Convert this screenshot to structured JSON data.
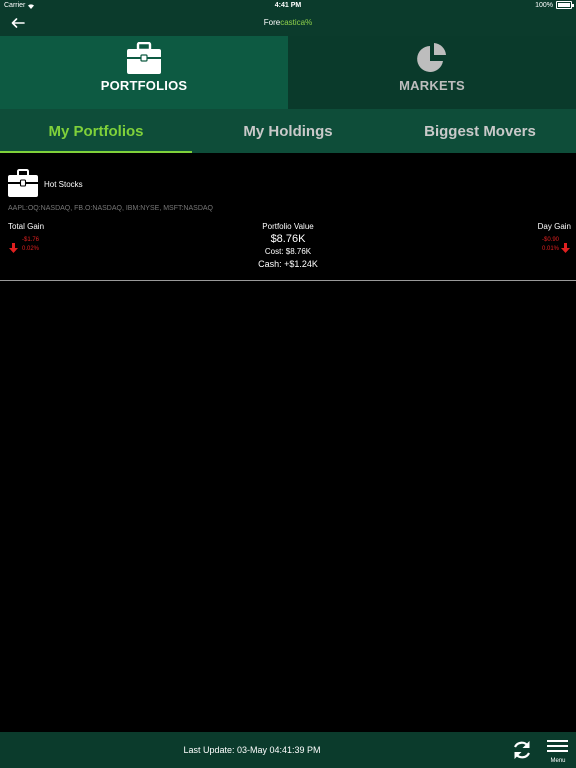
{
  "status_bar": {
    "carrier": "Carrier",
    "time": "4:41 PM",
    "battery": "100%",
    "battery_level": 1.0
  },
  "nav": {
    "brand_prefix": "Fore",
    "brand_accent": "castica",
    "brand_suffix": "%",
    "back_icon": "back-arrow-icon"
  },
  "main_tabs": [
    {
      "label": "PORTFOLIOS",
      "icon": "briefcase-icon",
      "active": true
    },
    {
      "label": "MARKETS",
      "icon": "pie-chart-icon",
      "active": false
    }
  ],
  "sub_tabs": [
    {
      "label": "My Portfolios",
      "active": true
    },
    {
      "label": "My Holdings",
      "active": false
    },
    {
      "label": "Biggest Movers",
      "active": false
    }
  ],
  "portfolio": {
    "name": "Hot Stocks",
    "icon": "briefcase-icon",
    "symbols": "AAPL:OQ:NASDAQ, FB.O:NASDAQ, IBM:NYSE, MSFT:NASDAQ",
    "total_gain": {
      "label": "Total Gain",
      "amount": "-$1.76",
      "percent": "0.02%",
      "direction": "down"
    },
    "portfolio_value": {
      "label": "Portfolio Value",
      "value": "$8.76K",
      "cost": "Cost: $8.76K",
      "cash": "Cash: +$1.24K"
    },
    "day_gain": {
      "label": "Day Gain",
      "amount": "-$0.90",
      "percent": "0.01%",
      "direction": "down"
    }
  },
  "bottom_bar": {
    "last_update": "Last Update: 03-May 04:41:39 PM",
    "refresh_icon": "refresh-icon",
    "menu_label": "Menu",
    "menu_icon": "hamburger-menu-icon"
  },
  "colors": {
    "header_bg": "#0b3b2c",
    "tab_active_bg": "#0d5a42",
    "subtab_bg": "#0e4d39",
    "accent_green": "#7fd13a",
    "loss_red": "#e02020"
  }
}
